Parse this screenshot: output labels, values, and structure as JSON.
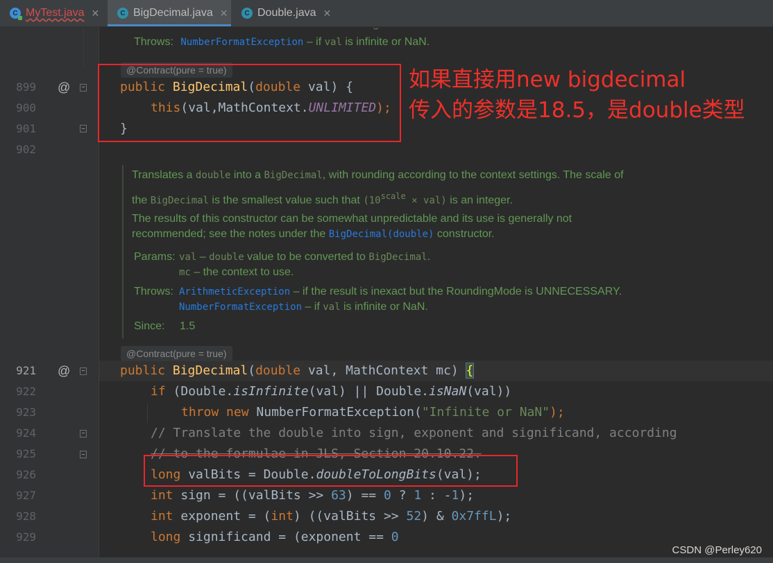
{
  "tabs": [
    {
      "label": "MyTest.java",
      "icon": "java-class-run-icon"
    },
    {
      "label": "BigDecimal.java",
      "icon": "java-class-icon"
    },
    {
      "label": "Double.java",
      "icon": "java-class-icon"
    }
  ],
  "top_doc": {
    "params_clip": "Params: val – double value to be converted to BigDecimal.",
    "throws_label": "Throws:",
    "throws_link": "NumberFormatException",
    "throws_text1": " – if ",
    "throws_code": "val",
    "throws_text2": " is infinite or NaN."
  },
  "contract_label": "@Contract(pure = true)",
  "line_numbers": {
    "l899": "899",
    "l900": "900",
    "l901": "901",
    "l902": "902",
    "l921": "921",
    "l922": "922",
    "l923": "923",
    "l924": "924",
    "l925": "925",
    "l926": "926",
    "l927": "927",
    "l928": "928",
    "l929": "929"
  },
  "code1": {
    "public": "public ",
    "name": "BigDecimal",
    "open": "(",
    "double": "double",
    "rest": " val) {",
    "this": "this",
    "args": "(val,MathContext.",
    "unlimited": "UNLIMITED",
    "end": ");",
    "close": "}"
  },
  "doc": {
    "p1_a": "Translates a ",
    "p1_code1": "double",
    "p1_b": " into a ",
    "p1_code2": "BigDecimal",
    "p1_c": ", with rounding according to the context settings. The scale of",
    "p2_a": "the ",
    "p2_code1": "BigDecimal",
    "p2_b": " is the smallest value such that ",
    "p2_code2": "(10",
    "p2_sup": "scale",
    "p2_code3": " × val)",
    "p2_c": " is an integer.",
    "p3_a": "The results of this constructor can be somewhat unpredictable and its use is generally not",
    "p3_b": "recommended; see the notes under the ",
    "p3_link": "BigDecimal(double)",
    "p3_c": " constructor.",
    "params_label": "Params:",
    "param1_code": "val",
    "param1_a": " – ",
    "param1_code2": "double",
    "param1_b": " value to be converted to ",
    "param1_code3": "BigDecimal",
    "param1_c": ".",
    "param2_code": "mc",
    "param2_a": " – the context to use.",
    "throws_label": "Throws:",
    "throws1_link": "ArithmeticException",
    "throws1_text": " – if the result is inexact but the RoundingMode is UNNECESSARY.",
    "throws2_link": "NumberFormatException",
    "throws2_a": " – if ",
    "throws2_code": "val",
    "throws2_b": " is infinite or NaN.",
    "since_label": "Since:",
    "since_value": "1.5"
  },
  "code2": {
    "l921_public": "public ",
    "l921_name": "BigDecimal",
    "l921_open": "(",
    "l921_double": "double",
    "l921_mid": " val, MathContext mc) ",
    "l921_brace": "{",
    "l922_if": "if",
    "l922_a": " (Double.",
    "l922_m1": "isInfinite",
    "l922_b": "(val) || Double.",
    "l922_m2": "isNaN",
    "l922_c": "(val))",
    "l923_throw": "throw ",
    "l923_new": "new ",
    "l923_a": "NumberFormatException(",
    "l923_str": "\"Infinite or NaN\"",
    "l923_b": ");",
    "l924_cmt": "// Translate the double into sign, exponent and significand, according",
    "l925_cmt": "// to the formulae in JLS, Section 20.10.22.",
    "l926_long": "long",
    "l926_a": " valBits = Double.",
    "l926_m": "doubleToLongBits",
    "l926_b": "(val);",
    "l927_int": "int",
    "l927_a": " sign = ((valBits >> ",
    "l927_n1": "63",
    "l927_b": ") == ",
    "l927_n2": "0",
    "l927_c": " ? ",
    "l927_n3": "1",
    "l927_d": " : -",
    "l927_n4": "1",
    "l927_e": ");",
    "l928_int": "int",
    "l928_a": " exponent = (",
    "l928_int2": "int",
    "l928_b": ") ((valBits >> ",
    "l928_n1": "52",
    "l928_c": ") & ",
    "l928_n2": "0x7ffL",
    "l928_d": ");",
    "l929_long": "long",
    "l929_a": " significand = (exponent == ",
    "l929_n": "0"
  },
  "annotation": {
    "line1": "如果直接用new bigdecimal",
    "line2": "传入的参数是18.5，是double类型"
  },
  "watermark": "CSDN @Perley620",
  "colors": {
    "keyword": "#cc7832",
    "method_decl": "#ffc66d",
    "static_field": "#9876aa",
    "number": "#6897bb",
    "string": "#6a8759",
    "comment": "#808080",
    "doc_text": "#629755",
    "doc_link": "#287bde",
    "annotation_red": "#e8262b"
  }
}
